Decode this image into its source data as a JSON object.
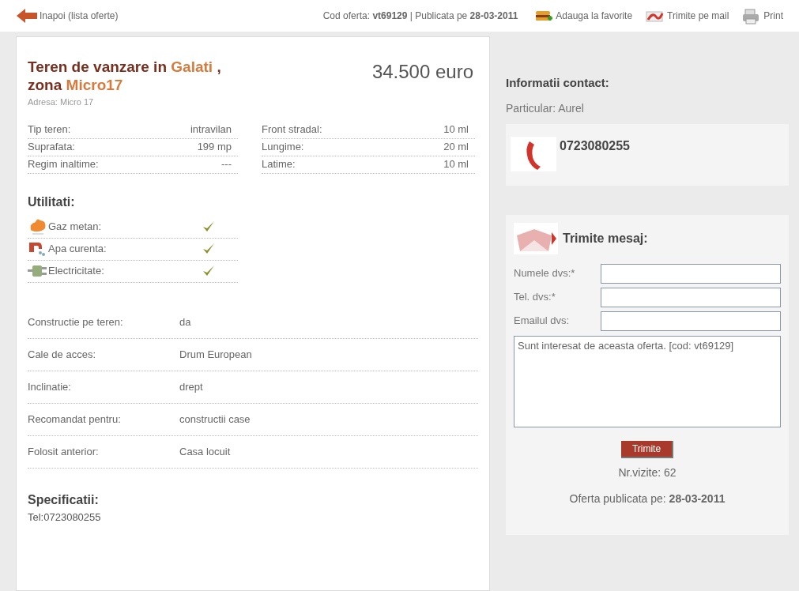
{
  "top_bar": {
    "back_link": "Inapoi (lista oferte)",
    "offer_info": "Cod oferta: **vt69129** | Publicata pe **28-03-2011**",
    "actions": [
      {
        "label": "Adauga la favorite",
        "kind": "favorite"
      },
      {
        "label": "Trimite pe mail",
        "kind": "mail"
      },
      {
        "label": "Print",
        "kind": "print"
      }
    ]
  },
  "listing": {
    "title_parts": [
      {
        "text": "Teren de vanzare in",
        "kind": "plain"
      },
      {
        "text": "Galati",
        "kind": "highlight"
      },
      {
        "text": ", zona",
        "kind": "plain"
      },
      {
        "text": "Micro17",
        "kind": "highlight"
      }
    ],
    "price": "34.500 euro",
    "address": "Adresa: Micro 17",
    "specs_left": [
      {
        "label": "Tip teren:",
        "value": "intravilan"
      },
      {
        "label": "Suprafata:",
        "value": "199 mp"
      },
      {
        "label": "Regim inaltime:",
        "value": "---"
      }
    ],
    "specs_right": [
      {
        "label": "Front stradal:",
        "value": "10 ml"
      },
      {
        "label": "Lungime:",
        "value": "20 ml"
      },
      {
        "label": "Latime:",
        "value": "10 ml"
      }
    ],
    "utilities_heading": "Utilitati:",
    "utilities": [
      {
        "label": "Gaz metan:",
        "kind": "gas",
        "checked": true
      },
      {
        "label": "Apa curenta:",
        "kind": "water",
        "checked": true
      },
      {
        "label": "Electricitate:",
        "kind": "electricity",
        "checked": true
      }
    ],
    "details": [
      {
        "label": "Constructie pe teren:",
        "value": "da"
      },
      {
        "label": "Cale de acces:",
        "value": "Drum European"
      },
      {
        "label": "Inclinatie:",
        "value": "drept"
      },
      {
        "label": "Recomandat pentru:",
        "value": "constructii case"
      },
      {
        "label": "Folosit anterior:",
        "value": "Casa locuit"
      }
    ],
    "specifications_heading": "Specificatii:",
    "specifications_text": "Tel:0723080255"
  },
  "contact": {
    "heading": "Informatii contact:",
    "owner": "Particular: Aurel",
    "phone": "0723080255"
  },
  "message_form": {
    "heading": "Trimite mesaj:",
    "fields": [
      {
        "label": "Numele dvs:*"
      },
      {
        "label": "Tel. dvs:*"
      },
      {
        "label": "Emailul dvs:"
      }
    ],
    "message": "Sunt interesat de aceasta oferta. [cod: vt69129]",
    "submit": "Trimite",
    "visits": "Nr.vizite: 62",
    "published": "Oferta publicata pe: **28-03-2011**"
  }
}
